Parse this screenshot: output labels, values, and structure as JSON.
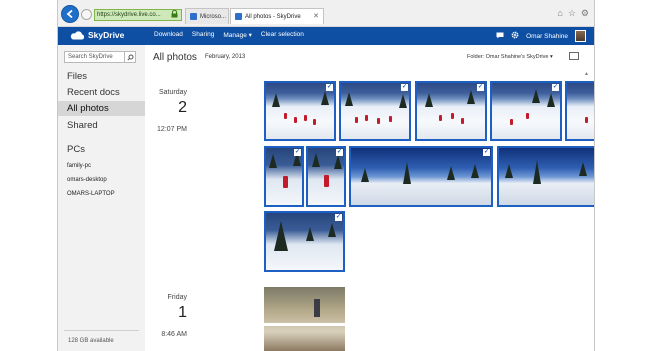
{
  "browser": {
    "address": "https://skydrive.live.co...",
    "tabs": [
      {
        "label": "Microso..."
      },
      {
        "label": "All photos - SkyDrive"
      }
    ]
  },
  "appbar": {
    "brand": "SkyDrive",
    "actions": [
      "Download",
      "Sharing",
      "Manage",
      "Clear selection"
    ],
    "manage_suffix": "▾",
    "user_name": "Omar Shahine"
  },
  "sidebar": {
    "search_placeholder": "Search SkyDrive",
    "items": [
      {
        "label": "Files"
      },
      {
        "label": "Recent docs"
      },
      {
        "label": "All photos"
      },
      {
        "label": "Shared"
      }
    ],
    "pcs_heading": "PCs",
    "pcs": [
      {
        "label": "family-pc"
      },
      {
        "label": "omars-desktop"
      },
      {
        "label": "OMARS-LAPTOP"
      }
    ],
    "storage": "128 GB available"
  },
  "main": {
    "title": "All photos",
    "month": "February, 2013",
    "folder": "Folder: Omar Shahine's SkyDrive ▾",
    "days": [
      {
        "weekday": "Saturday",
        "day": "2",
        "time": "12:07 PM"
      },
      {
        "weekday": "Friday",
        "day": "1",
        "time": "8:46 AM"
      }
    ]
  },
  "colors": {
    "accent": "#0e4fa3",
    "selection": "#1d5fc3",
    "sidebar_bg": "#f2f2f2",
    "sidebar_active": "#d6d6d6",
    "address_bg": "#cfe8b9"
  },
  "icons": [
    "back-arrow-icon",
    "forward-arrow-icon",
    "lock-icon",
    "close-icon",
    "home-icon",
    "star-icon",
    "gear-icon",
    "cloud-icon",
    "chat-icon",
    "search-icon",
    "view-toggle-icon",
    "checkmark-icon"
  ]
}
